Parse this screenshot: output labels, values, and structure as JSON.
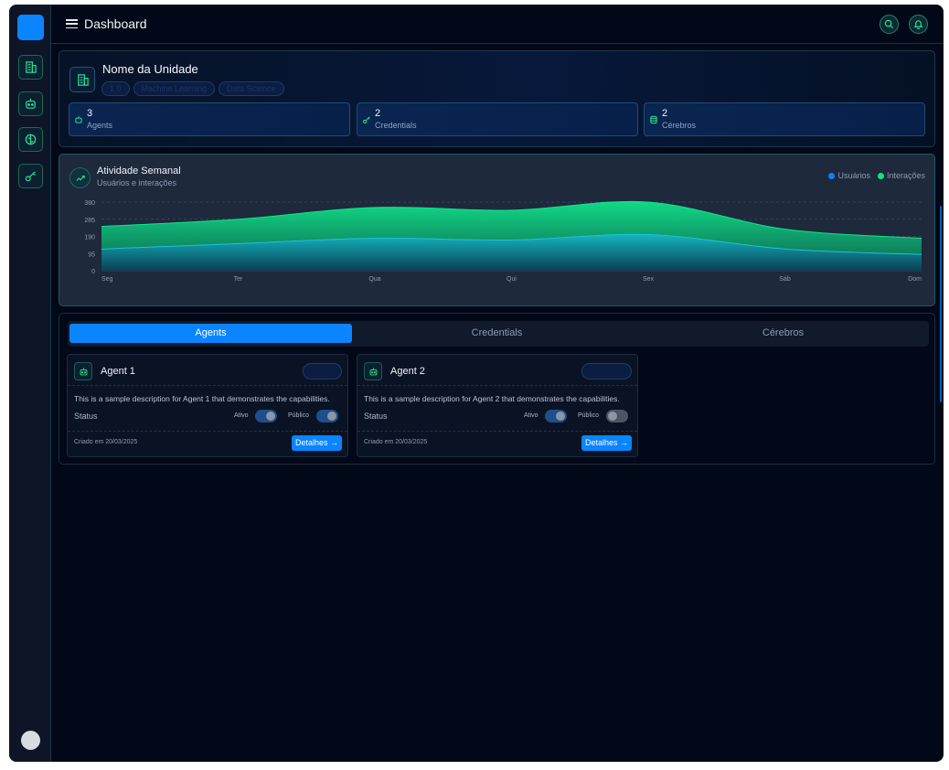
{
  "header": {
    "title": "Dashboard"
  },
  "unit": {
    "name": "Nome da Unidade",
    "tags": [
      "1.0",
      "Machine Learning",
      "Data Science"
    ]
  },
  "stats": [
    {
      "value": "3",
      "label": "Agents",
      "icon": "robot-icon"
    },
    {
      "value": "2",
      "label": "Credentials",
      "icon": "key-icon"
    },
    {
      "value": "2",
      "label": "Cérebros",
      "icon": "database-icon"
    }
  ],
  "chart": {
    "title": "Atividade Semanal",
    "subtitle": "Usuários e interações"
  },
  "chart_data": {
    "type": "area",
    "stacked": true,
    "categories": [
      "Seg",
      "Ter",
      "Qua",
      "Qui",
      "Sex",
      "Sáb",
      "Dom"
    ],
    "series": [
      {
        "name": "Usuários",
        "color": "#0a84ff",
        "values": [
          120,
          150,
          180,
          170,
          200,
          120,
          90
        ]
      },
      {
        "name": "Interações",
        "color": "#10e38a",
        "values": [
          125,
          135,
          170,
          165,
          180,
          110,
          90
        ]
      }
    ],
    "yticks": [
      0,
      95,
      190,
      285,
      380
    ],
    "ylim": [
      0,
      380
    ],
    "grid": true,
    "legend_position": "top-right"
  },
  "tabs": [
    "Agents",
    "Credentials",
    "Cérebros"
  ],
  "agents": [
    {
      "name": "Agent 1",
      "description": "This is a sample description for Agent 1 that demonstrates the capabilities.",
      "status_label": "Status",
      "active_label": "Ativo",
      "public_label": "Público",
      "active": true,
      "public": true,
      "created": "Criado em 20/03/2025",
      "details": "Detalhes →"
    },
    {
      "name": "Agent 2",
      "description": "This is a sample description for Agent 2 that demonstrates the capabilities.",
      "status_label": "Status",
      "active_label": "Ativo",
      "public_label": "Público",
      "active": true,
      "public": false,
      "created": "Criado em 20/03/2025",
      "details": "Detalhes →"
    }
  ]
}
